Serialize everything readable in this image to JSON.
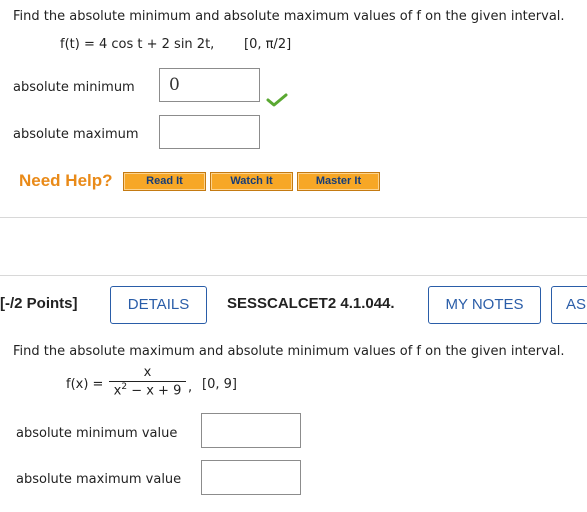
{
  "q1": {
    "prompt": "Find the absolute minimum and absolute maximum values of f on the given interval.",
    "function": "f(t)  =  4 cos t + 2 sin 2t,",
    "interval": "[0, π/2]",
    "min_label": "absolute minimum",
    "min_value": "0",
    "max_label": "absolute maximum",
    "max_value": ""
  },
  "help": {
    "label": "Need Help?",
    "read": "Read It",
    "watch": "Watch It",
    "master": "Master It"
  },
  "q2": {
    "points": "[-/2 Points]",
    "details": "DETAILS",
    "code": "SESSCALCET2 4.1.044.",
    "notes": "MY NOTES",
    "ask": "AS",
    "prompt": "Find the absolute maximum and absolute minimum values of f on the given interval.",
    "fx": "f(x)  =",
    "numerator": "x",
    "denominator_base": "x",
    "denominator_exp": "2",
    "denominator_rest": " − x + 9",
    "comma": ",",
    "interval": "[0, 9]",
    "min_label": "absolute minimum value",
    "min_value": "",
    "max_label": "absolute maximum value",
    "max_value": ""
  },
  "icons": {
    "correct": "check-mark-icon"
  },
  "colors": {
    "check": "#5aa832",
    "help": "#e98a18",
    "button": "#f7a726",
    "link": "#2a5da8"
  }
}
